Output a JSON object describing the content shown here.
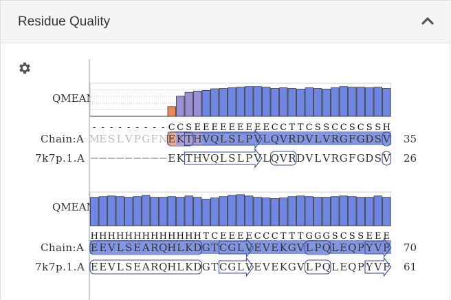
{
  "panel": {
    "title": "Residue Quality",
    "settings_icon": "gear-icon",
    "collapse_icon": "chevron-up-icon"
  },
  "colors": {
    "bar_blue": "#6f86e3",
    "bar_violet": "#9a90d8",
    "bar_orange": "#e8875a",
    "chain_highlight_blue": "#6c84de",
    "chain_highlight_orange": "#e59a75"
  },
  "blocks": [
    {
      "track_label": "QMEAN",
      "chain_label": "Chain:A",
      "template_label": "7k7p.1.A",
      "chain_number": "35",
      "template_number": "26",
      "secondary_structure": "---------CCSEEEEEEEEECCTTCSSCCSCSSH",
      "chain_sequence": "MESLVPGFNEKTHVQLSLPVLQVRDVLVRGFGDSV",
      "template_sequence": "---------EKTHVQLSLPVLQVRDVLVRGFGDSV",
      "qmean": [
        0,
        0,
        0,
        0,
        0,
        0,
        0,
        0,
        0,
        0.3,
        0.62,
        0.74,
        0.78,
        0.8,
        0.85,
        0.86,
        0.88,
        0.9,
        0.92,
        0.92,
        0.9,
        0.86,
        0.88,
        0.86,
        0.84,
        0.88,
        0.86,
        0.84,
        0.88,
        0.92,
        0.9,
        0.9,
        0.88,
        0.9,
        0.86
      ]
    },
    {
      "track_label": "QMEAN",
      "chain_label": "Chain:A",
      "template_label": "7k7p.1.A",
      "chain_number": "70",
      "template_number": "61",
      "secondary_structure": "HHHHHHHHHHHHHTCEEEECCCTTTGGGSCSSEEE",
      "chain_sequence": "EEVLSEARQHLKDGTCGLVEVEKGVLPQLEQPYVF",
      "template_sequence": "EEVLSEARQHLKDGTCGLVEVEKGVLPQLEQPYVF",
      "qmean": [
        0.86,
        0.88,
        0.9,
        0.88,
        0.86,
        0.88,
        0.92,
        0.86,
        0.86,
        0.88,
        0.86,
        0.9,
        0.86,
        0.8,
        0.84,
        0.88,
        0.92,
        0.94,
        0.9,
        0.86,
        0.84,
        0.82,
        0.84,
        0.88,
        0.9,
        0.88,
        0.86,
        0.86,
        0.88,
        0.9,
        0.88,
        0.86,
        0.86,
        0.9,
        0.86
      ]
    }
  ]
}
